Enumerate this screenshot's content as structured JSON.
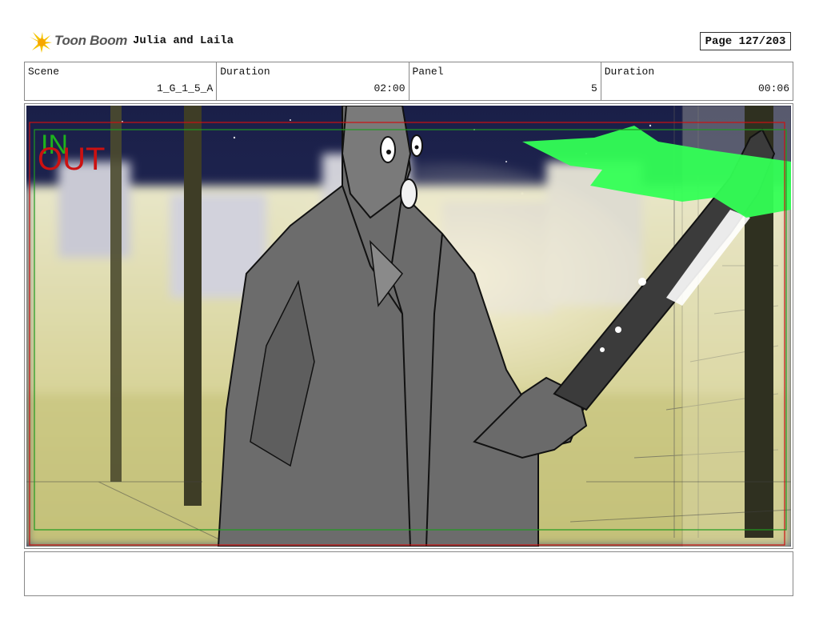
{
  "header": {
    "logo_text": "Toon Boom",
    "project_title": "Julia and Laila",
    "page_label": "Page 127/203"
  },
  "info": {
    "scene_label": "Scene",
    "scene_value": "1_G_1_5_A",
    "duration1_label": "Duration",
    "duration1_value": "02:00",
    "panel_label": "Panel",
    "panel_value": "5",
    "duration2_label": "Duration",
    "duration2_value": "00:06"
  },
  "panel_overlay": {
    "in_label": "IN",
    "out_label": "OUT",
    "in_color": "#1db31d",
    "out_color": "#cc1111"
  },
  "notes": ""
}
